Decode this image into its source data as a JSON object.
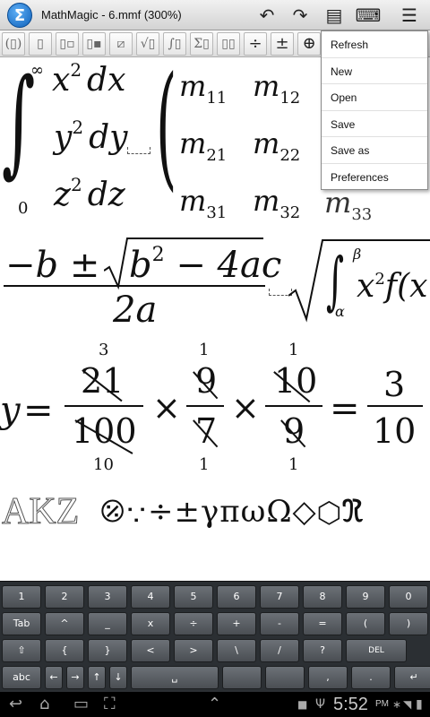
{
  "titlebar": {
    "logo_glyph": "Σ",
    "title": "MathMagic  - 6.mmf (300%)",
    "undo_icon": "↶",
    "redo_icon": "↷",
    "clipboard_icon": "▤",
    "keyboard_icon": "⌨",
    "menu_icon": "☰"
  },
  "palette": {
    "items": [
      {
        "name": "parens-template-button",
        "glyph": "(▯)"
      },
      {
        "name": "fraction-template-button",
        "glyph": "▯"
      },
      {
        "name": "subscript-template-button",
        "glyph": "▯▫"
      },
      {
        "name": "superscript-template-button",
        "glyph": "▯▪"
      },
      {
        "name": "strikeout-template-button",
        "glyph": "⧄"
      },
      {
        "name": "radical-template-button",
        "glyph": "√▯"
      },
      {
        "name": "integral-template-button",
        "glyph": "∫▯"
      },
      {
        "name": "sum-template-button",
        "glyph": "Σ▯"
      },
      {
        "name": "matrix-template-button",
        "glyph": "▯▯"
      },
      {
        "name": "divide-button",
        "glyph": "÷"
      },
      {
        "name": "plus-minus-button",
        "glyph": "±"
      },
      {
        "name": "circle-plus-button",
        "glyph": "⊕"
      }
    ]
  },
  "menu": {
    "items": [
      "Refresh",
      "New",
      "Open",
      "Save",
      "Save as",
      "Preferences"
    ]
  },
  "math": {
    "integral_sign": "∫",
    "int_upper": "∞",
    "int_lower": "0",
    "rows": [
      {
        "v": "x",
        "p": "2",
        "d": "dx"
      },
      {
        "v": "y",
        "p": "2",
        "d": "dy"
      },
      {
        "v": "z",
        "p": "2",
        "d": "dz"
      }
    ],
    "paren_left": "(",
    "matrix": [
      [
        "m",
        "11",
        "m",
        "12"
      ],
      [
        "m",
        "21",
        "m",
        "22"
      ],
      [
        "m",
        "31",
        "m",
        "32"
      ]
    ],
    "matrix_partial": "m",
    "matrix_partial_sub": "33",
    "paren_right": ")",
    "quad_numerator_pre": "−b ±",
    "quad_radicand_b": "b",
    "quad_radicand_pow": "2",
    "quad_radicand_rest": " − 4ac",
    "quad_denominator": "2a",
    "root_int_sign": "∫",
    "root_int_upper": "β",
    "root_int_lower": "α",
    "root_body_x": "x",
    "root_body_pow": "2",
    "root_body_rest": "f(x",
    "cancel_y": "y",
    "eq": "=",
    "times": "×",
    "f1": {
      "above": "3",
      "num": "21",
      "den": "100",
      "below": "10"
    },
    "f2": {
      "above": "1",
      "num": "9",
      "den": "7",
      "below": "1"
    },
    "f3": {
      "above": "1",
      "num": "10",
      "den": "9",
      "below": "1"
    },
    "result": {
      "num": "3",
      "den": "10"
    },
    "outline_text": "AKZ",
    "symbols": "⦼∵÷±γπωΩ◇⬡ℜ"
  },
  "keyboard": {
    "row1": [
      "1",
      "2",
      "3",
      "4",
      "5",
      "6",
      "7",
      "8",
      "9",
      "0"
    ],
    "row2": [
      "Tab",
      "^",
      "_",
      "x",
      "÷",
      "+",
      "-",
      "=",
      "(",
      ")"
    ],
    "row3": [
      "⇧",
      "{",
      "}",
      "<",
      ">",
      "\\",
      "/",
      "?",
      "DEL"
    ],
    "row4": [
      "abc",
      "←",
      "→",
      "↑",
      "↓",
      "␣",
      "",
      "",
      ",",
      ".",
      "↵"
    ]
  },
  "navbar": {
    "back_icon": "↩",
    "home_icon": "⌂",
    "recent_icon": "▭",
    "screenshot_icon": "⛶",
    "up_icon": "⌃",
    "bag_icon": "■",
    "usb_icon": "Ψ",
    "time": "5:52",
    "ampm": "PM",
    "bt_icon": "∗",
    "wifi_icon": "◥",
    "battery_icon": "▮"
  }
}
